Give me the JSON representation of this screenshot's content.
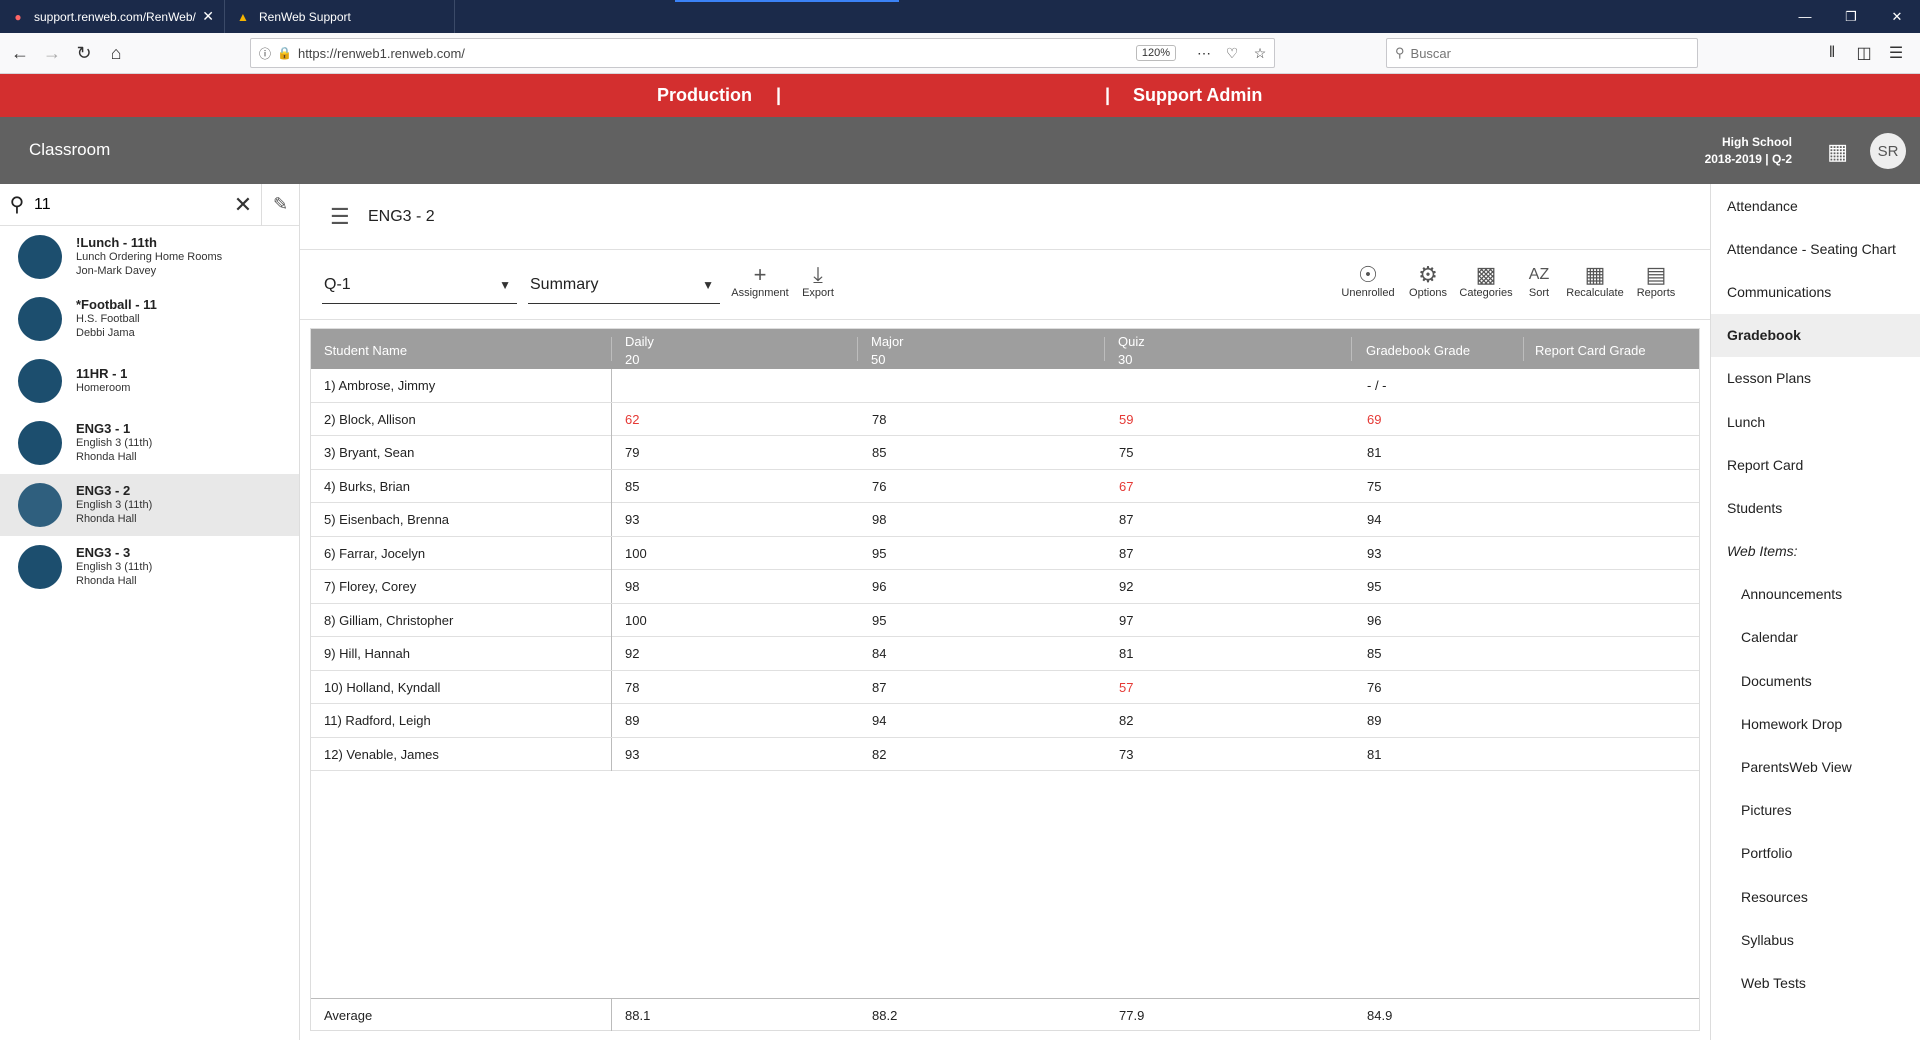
{
  "browser": {
    "tabs": [
      {
        "title": "support.renweb.com/RenWeb/",
        "favicon": "renweb-icon"
      },
      {
        "title": "RenWeb Support",
        "favicon": "renweb-support-icon"
      }
    ],
    "url": "https://renweb1.renweb.com/",
    "zoom": "120%",
    "search_placeholder": "Buscar"
  },
  "env_bar": {
    "left": "Production",
    "sep_left": "|",
    "sep_right": "|",
    "right": "Support Admin"
  },
  "app_header": {
    "title": "Classroom",
    "school": "High School",
    "term": "2018-2019 | Q-2",
    "avatar": "SR"
  },
  "left_panel": {
    "search_value": "11",
    "classes": [
      {
        "name": "!Lunch - 11th",
        "line1": "Lunch Ordering Home Rooms",
        "line2": "Jon-Mark Davey"
      },
      {
        "name": "*Football - 11",
        "line1": "H.S. Football",
        "line2": "Debbi Jama"
      },
      {
        "name": "11HR - 1",
        "line1": "Homeroom",
        "line2": ""
      },
      {
        "name": "ENG3 - 1",
        "line1": "English 3 (11th)",
        "line2": "Rhonda Hall"
      },
      {
        "name": "ENG3 - 2",
        "line1": "English 3 (11th)",
        "line2": "Rhonda Hall"
      },
      {
        "name": "ENG3 - 3",
        "line1": "English 3 (11th)",
        "line2": "Rhonda Hall"
      }
    ]
  },
  "main": {
    "section_title": "ENG3 - 2",
    "term_select": "Q-1",
    "view_select": "Summary",
    "tools_left": [
      {
        "label": "Assignment",
        "icon": "plus-icon"
      },
      {
        "label": "Export",
        "icon": "download-icon"
      }
    ],
    "tools_right": [
      {
        "label": "Unenrolled",
        "icon": "person-icon"
      },
      {
        "label": "Options",
        "icon": "gear-icon"
      },
      {
        "label": "Categories",
        "icon": "folder-icon"
      },
      {
        "label": "Sort",
        "icon": "sort-az-icon"
      },
      {
        "label": "Recalculate",
        "icon": "recalculate-icon"
      },
      {
        "label": "Reports",
        "icon": "bar-chart-icon"
      }
    ],
    "table": {
      "headers": {
        "name": "Student Name",
        "daily": "Daily",
        "daily_weight": "20",
        "major": "Major",
        "major_weight": "50",
        "quiz": "Quiz",
        "quiz_weight": "30",
        "gradebook": "Gradebook Grade",
        "reportcard": "Report Card Grade"
      },
      "rows": [
        {
          "name": "1) Ambrose, Jimmy",
          "daily": "",
          "major": "",
          "quiz": "",
          "grade": "- / -"
        },
        {
          "name": "2) Block, Allison",
          "daily": "62",
          "major": "78",
          "quiz": "59",
          "grade": "69"
        },
        {
          "name": "3) Bryant, Sean",
          "daily": "79",
          "major": "85",
          "quiz": "75",
          "grade": "81"
        },
        {
          "name": "4) Burks, Brian",
          "daily": "85",
          "major": "76",
          "quiz": "67",
          "grade": "75"
        },
        {
          "name": "5) Eisenbach, Brenna",
          "daily": "93",
          "major": "98",
          "quiz": "87",
          "grade": "94"
        },
        {
          "name": "6) Farrar, Jocelyn",
          "daily": "100",
          "major": "95",
          "quiz": "87",
          "grade": "93"
        },
        {
          "name": "7) Florey, Corey",
          "daily": "98",
          "major": "96",
          "quiz": "92",
          "grade": "95"
        },
        {
          "name": "8) Gilliam, Christopher",
          "daily": "100",
          "major": "95",
          "quiz": "97",
          "grade": "96"
        },
        {
          "name": "9) Hill, Hannah",
          "daily": "92",
          "major": "84",
          "quiz": "81",
          "grade": "85"
        },
        {
          "name": "10) Holland, Kyndall",
          "daily": "78",
          "major": "87",
          "quiz": "57",
          "grade": "76"
        },
        {
          "name": "11) Radford, Leigh",
          "daily": "89",
          "major": "94",
          "quiz": "82",
          "grade": "89"
        },
        {
          "name": "12) Venable, James",
          "daily": "93",
          "major": "82",
          "quiz": "73",
          "grade": "81"
        }
      ],
      "average": {
        "label": "Average",
        "daily": "88.1",
        "major": "88.2",
        "quiz": "77.9",
        "grade": "84.9"
      }
    }
  },
  "right_nav": {
    "items": [
      "Attendance",
      "Attendance - Seating Chart",
      "Communications",
      "Gradebook",
      "Lesson Plans",
      "Lunch",
      "Report Card",
      "Students"
    ],
    "web_items_header": "Web Items:",
    "web_items": [
      "Announcements",
      "Calendar",
      "Documents",
      "Homework Drop",
      "ParentsWeb View",
      "Pictures",
      "Portfolio",
      "Resources",
      "Syllabus",
      "Web Tests"
    ]
  },
  "colors": {
    "env_bar": "#d32f2f",
    "header": "#616161",
    "class_dot": "#1c4e6e",
    "low_grade": "#e53935",
    "table_header": "#9e9e9e"
  }
}
